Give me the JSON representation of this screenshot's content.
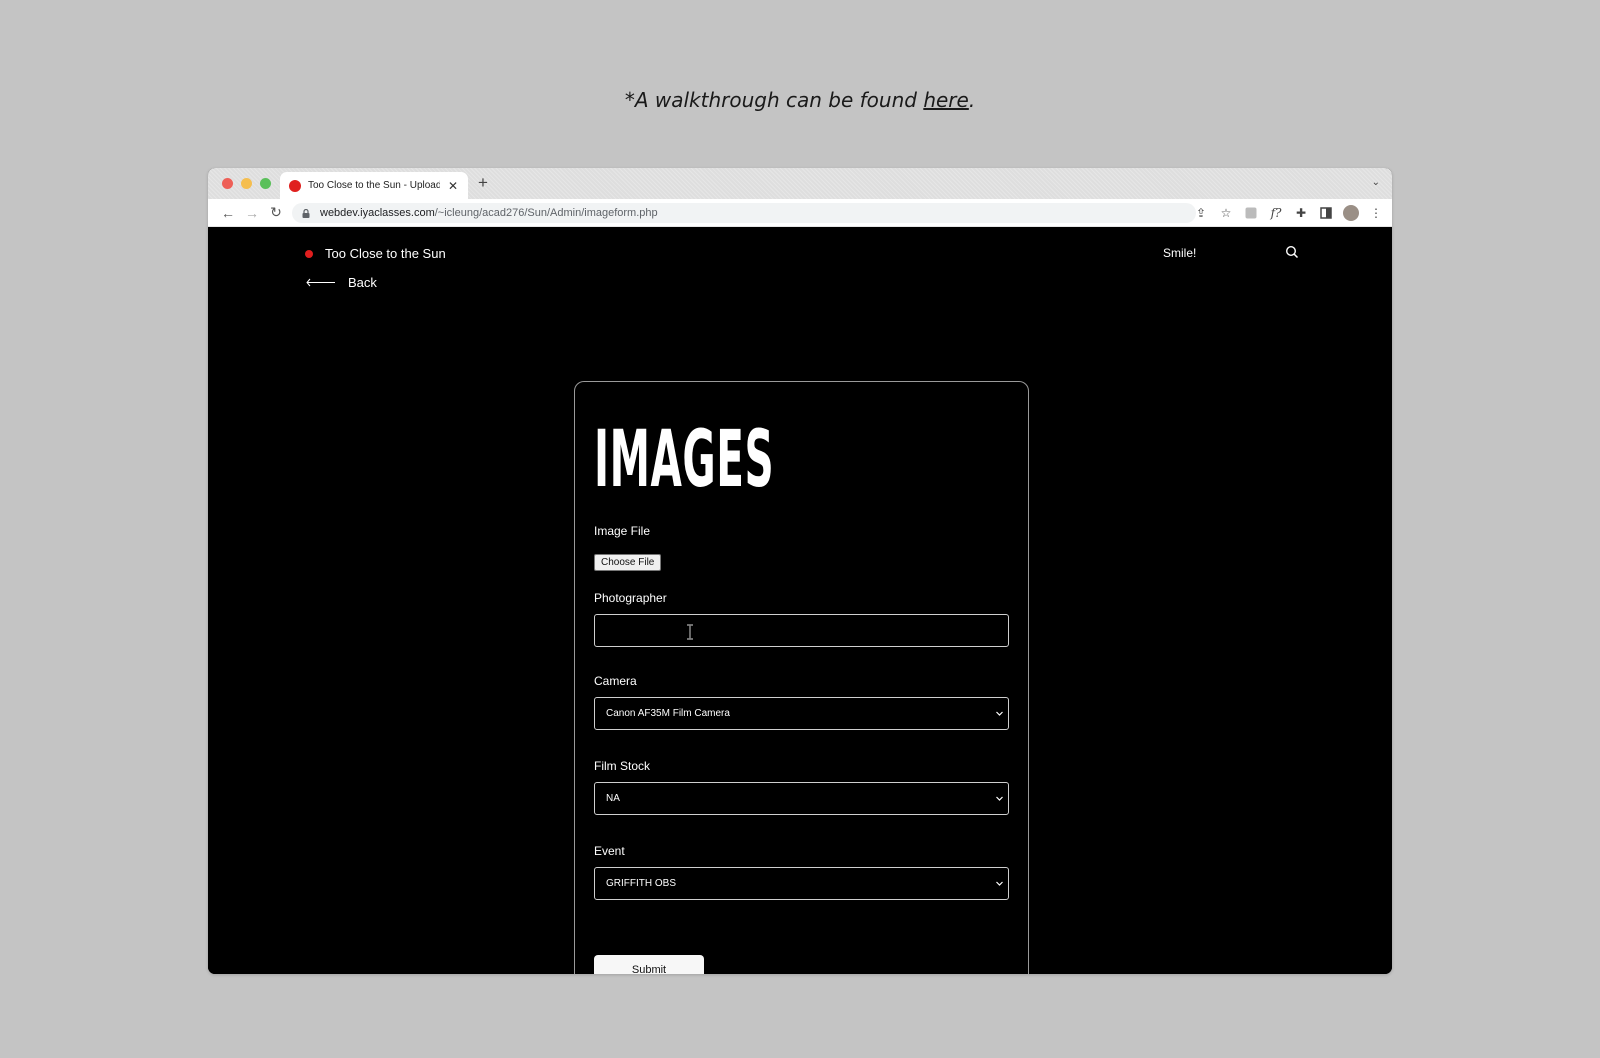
{
  "caption": {
    "prefix": "*A walkthrough can be found ",
    "link": "here",
    "suffix": "."
  },
  "browser": {
    "tab_title": "Too Close to the Sun - Upload",
    "tab_close": "✕",
    "new_tab": "+",
    "tab_menu": "⌄",
    "url_host": "webdev.iyaclasses.com",
    "url_path": "/~icleung/acad276/Sun/Admin/imageform.php",
    "icons": [
      "back-arrow-icon",
      "forward-arrow-icon",
      "reload-icon",
      "share-icon",
      "star-icon",
      "extension-icon",
      "fonts-icon",
      "puzzle-icon",
      "sidepanel-icon",
      "profile-avatar",
      "kebab-menu-icon"
    ]
  },
  "nav": {
    "brand": "Too Close to the Sun",
    "back": "Back",
    "tagline": "Smile!"
  },
  "form": {
    "heading": "IMAGES",
    "image_file_label": "Image File",
    "choose_file": "Choose File",
    "photographer_label": "Photographer",
    "photographer_value": "",
    "camera_label": "Camera",
    "camera_value": "Canon AF35M Film Camera",
    "film_label": "Film Stock",
    "film_value": "NA",
    "event_label": "Event",
    "event_value": "GRIFFITH OBS",
    "submit": "Submit"
  },
  "colors": {
    "brand_dot": "#e01e1e",
    "page_bg": "#000000",
    "backdrop": "#c4c4c4"
  }
}
